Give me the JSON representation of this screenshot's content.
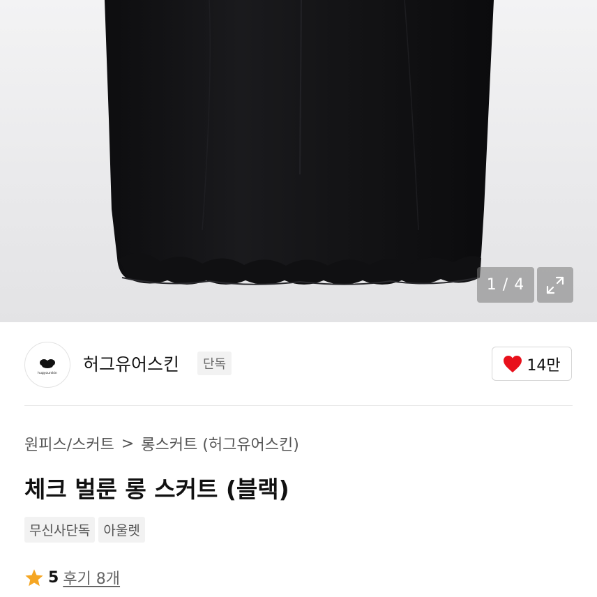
{
  "gallery": {
    "counter": "1 / 4",
    "expand_icon": "expand-arrows-icon"
  },
  "brand": {
    "name": "허그유어스킨",
    "exclusive_tag": "단독",
    "logo_text": "hugyourskin",
    "like_count": "14만",
    "like_icon": "heart-icon",
    "like_color": "#e8101b"
  },
  "breadcrumb": {
    "category": "원피스/스커트",
    "separator": ">",
    "subcategory": "롱스커트 (허그유어스킨)"
  },
  "product": {
    "title": "체크 벌룬 롱 스커트 (블랙)",
    "tags": [
      "무신사단독",
      "아울렛"
    ]
  },
  "rating": {
    "star_color": "#f5a623",
    "score": "5",
    "review_label": "후기 8개"
  }
}
